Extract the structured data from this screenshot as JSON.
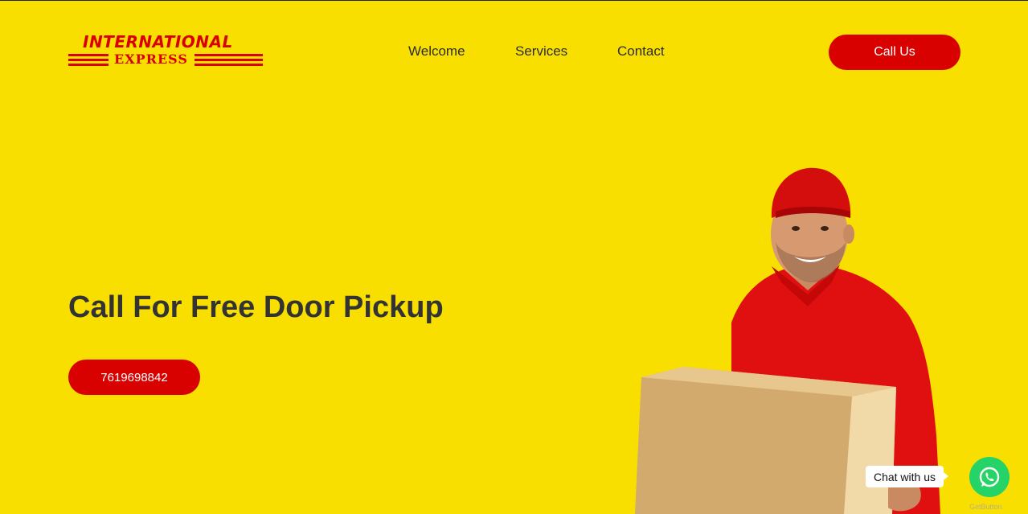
{
  "brand": {
    "line1": "INTERNATIONAL",
    "line2": "EXPRESS",
    "color": "#d90000"
  },
  "nav": {
    "items": [
      "Welcome",
      "Services",
      "Contact"
    ]
  },
  "header": {
    "call_label": "Call Us"
  },
  "hero": {
    "title": "Call For Free Door Pickup",
    "phone": "7619698842",
    "background": "#f8df00"
  },
  "chat": {
    "bubble_text": "Chat with us",
    "powered_by": "GetButton",
    "icon": "whatsapp-icon"
  }
}
